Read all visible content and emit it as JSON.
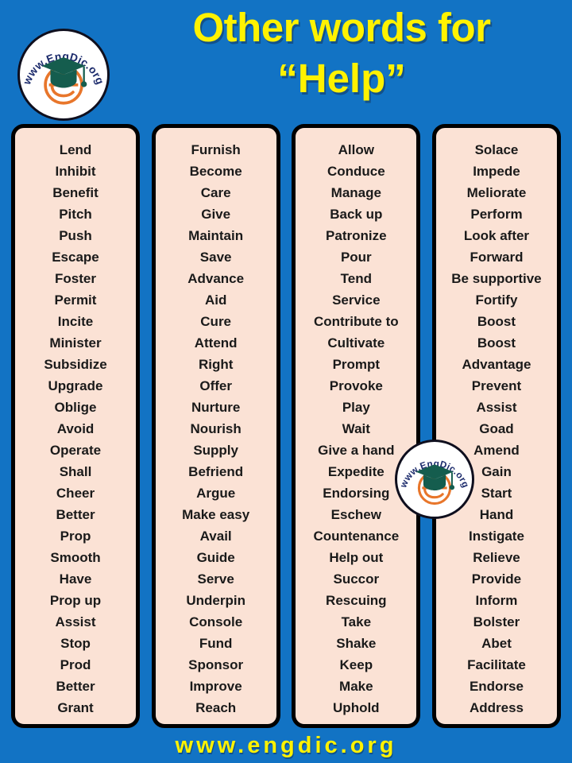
{
  "theme": {
    "background": "#1273C4",
    "card_fill": "#FBE2D5",
    "card_border": "#000000",
    "title_color": "#FFF200",
    "word_color": "#1a1a1a"
  },
  "header": {
    "title_line1": "Other words for",
    "title_line2": "“Help”",
    "logo_text": "www.EngDic.org",
    "logo_name": "engdic-logo"
  },
  "footer": {
    "url": "www.engdic.org"
  },
  "columns": [
    {
      "id": "column-1",
      "words": [
        "Lend",
        "Inhibit",
        "Benefit",
        "Pitch",
        "Push",
        "Escape",
        "Foster",
        "Permit",
        "Incite",
        "Minister",
        "Subsidize",
        "Upgrade",
        "Oblige",
        "Avoid",
        "Operate",
        "Shall",
        "Cheer",
        "Better",
        "Prop",
        "Smooth",
        "Have",
        "Prop up",
        "Assist",
        "Stop",
        "Prod",
        "Better",
        "Grant"
      ]
    },
    {
      "id": "column-2",
      "words": [
        "Furnish",
        "Become",
        "Care",
        "Give",
        "Maintain",
        "Save",
        "Advance",
        "Aid",
        "Cure",
        "Attend",
        "Right",
        "Offer",
        "Nurture",
        "Nourish",
        "Supply",
        "Befriend",
        "Argue",
        "Make easy",
        "Avail",
        "Guide",
        "Serve",
        "Underpin",
        "Console",
        "Fund",
        "Sponsor",
        "Improve",
        "Reach"
      ]
    },
    {
      "id": "column-3",
      "words": [
        "Allow",
        "Conduce",
        "Manage",
        "Back up",
        "Patronize",
        "Pour",
        "Tend",
        "Service",
        "Contribute  to",
        "Cultivate",
        "Prompt",
        "Provoke",
        "Play",
        "Wait",
        "Give a hand",
        "Expedite",
        "Endorsing",
        "Eschew",
        "Countenance",
        "Help out",
        "Succor",
        "Rescuing",
        "Take",
        "Shake",
        "Keep",
        "Make",
        "Uphold"
      ]
    },
    {
      "id": "column-4",
      "words": [
        "Solace",
        "Impede",
        "Meliorate",
        "Perform",
        "Look after",
        "Forward",
        "Be supportive",
        "Fortify",
        "Boost",
        "Boost",
        "Advantage",
        "Prevent",
        "Assist",
        "Goad",
        "Amend",
        "Gain",
        "Start",
        "Hand",
        "Instigate",
        "Relieve",
        "Provide",
        "Inform",
        "Bolster",
        "Abet",
        "Facilitate",
        "Endorse",
        "Address"
      ]
    }
  ]
}
